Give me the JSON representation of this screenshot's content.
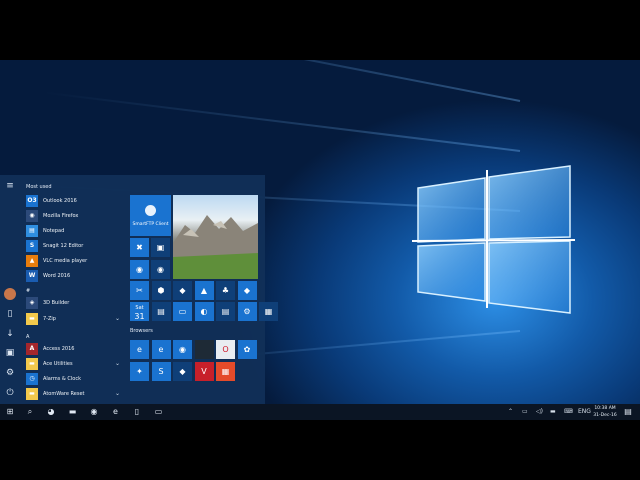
{
  "start_menu": {
    "most_used_header": "Most used",
    "most_used": [
      {
        "label": "Outlook 2016",
        "icon": "outlook-icon",
        "glyph": "O3",
        "color": "#1a73d0"
      },
      {
        "label": "Mozilla Firefox",
        "icon": "firefox-icon",
        "glyph": "◉",
        "color": "#2c4a7a"
      },
      {
        "label": "Notepad",
        "icon": "notepad-icon",
        "glyph": "▤",
        "color": "#2f8ee0"
      },
      {
        "label": "Snagit 12 Editor",
        "icon": "snagit-icon",
        "glyph": "S",
        "color": "#1a73d0"
      },
      {
        "label": "VLC media player",
        "icon": "vlc-icon",
        "glyph": "▲",
        "color": "#e87d0d"
      },
      {
        "label": "Word 2016",
        "icon": "word-icon",
        "glyph": "W",
        "color": "#1a5cb0"
      }
    ],
    "hash_header": "#",
    "hash_apps": [
      {
        "label": "3D Builder",
        "icon": "3d-builder-icon",
        "glyph": "◈",
        "color": "#2c4a7a",
        "expandable": false
      },
      {
        "label": "7-Zip",
        "icon": "folder-icon",
        "glyph": "▬",
        "color": "#f2c94c",
        "expandable": true
      }
    ],
    "a_header": "A",
    "a_apps": [
      {
        "label": "Access 2016",
        "icon": "access-icon",
        "glyph": "A",
        "color": "#a4262c",
        "expandable": false
      },
      {
        "label": "Ace Utilities",
        "icon": "folder-icon",
        "glyph": "▬",
        "color": "#f2c94c",
        "expandable": true
      },
      {
        "label": "Alarms & Clock",
        "icon": "alarm-clock-icon",
        "glyph": "◷",
        "color": "#1a73d0",
        "expandable": false
      },
      {
        "label": "AtomWare Reset",
        "icon": "folder-icon",
        "glyph": "▬",
        "color": "#f2c94c",
        "expandable": true
      }
    ],
    "chevron_glyph": "⌄",
    "rail": {
      "hamburger": "≡",
      "document": "▯",
      "download": "↓",
      "photos": "▣",
      "settings": "⚙",
      "power": "⏻"
    },
    "tiles": {
      "smartftp_label": "SmartFTP Client",
      "calendar_day": "Sat",
      "calendar_date": "31",
      "browsers_header": "Browsers",
      "row1_glyphs": [
        "✖",
        "▣"
      ],
      "row2_glyphs": [
        "◉",
        "◉"
      ],
      "row3_glyphs": [
        "✂",
        "⬢",
        "◆",
        "▲",
        "♣",
        "◆"
      ],
      "row4_glyphs": [
        "▤",
        "▭",
        "◐",
        "▤",
        "⚙",
        "▦"
      ],
      "browser_row1_glyphs": [
        "e",
        "e",
        "◉",
        "",
        "O",
        "✿"
      ],
      "browser_row2_glyphs": [
        "✦",
        "S",
        "◆",
        "V",
        "▦"
      ]
    }
  },
  "taskbar": {
    "start_glyph": "⊞",
    "search_glyph": "⌕",
    "pinned_glyphs": [
      "◕",
      "▬",
      "◉",
      "e",
      "▯",
      "▭"
    ],
    "tray_glyphs": [
      "⌃",
      "▭",
      "◁)",
      "▬",
      "⌨"
    ],
    "language": "ENG",
    "time": "10:38 AM",
    "date": "31-Dec-16",
    "notifications_glyph": "▤"
  },
  "colors": {
    "accent": "#1a73d0",
    "tile_dark": "#0f3f78",
    "start_bg": "#113058",
    "taskbar_bg": "#0b1524"
  }
}
